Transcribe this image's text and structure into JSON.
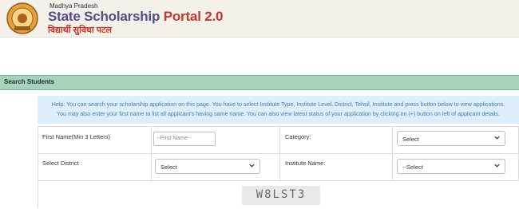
{
  "header": {
    "state_name": "Madhya Pradesh",
    "title_part1": "State Scholarship",
    "title_part2": "Portal 2.0",
    "hindi_tagline": "विद्यार्थी सुविधा पटल"
  },
  "section": {
    "title": "Search Students"
  },
  "help": {
    "line1": "Help: You can search your scholarship application on this page. You have to select Institute Type, Institute Level, District, Tehsil, Institute and press button below to view applications.",
    "line2": "You may also enter your first name to list all applicant's having same name. You can also view latest status of your application by clicking on (+) button on left of applicant details."
  },
  "form": {
    "first_name_label": "First Name(Min 3 Letters)",
    "first_name_placeholder": "--First Name--",
    "category_label": "Category:",
    "category_value": "Select",
    "district_label": "Select District :",
    "district_value": "Select",
    "institute_label": "Institute Name:",
    "institute_value": "--Select"
  },
  "captcha": {
    "text": "W8LST3"
  },
  "colors": {
    "section_bar": "#a7d3bd",
    "help_bg": "#dceef9",
    "title_purple": "#5a4a8a",
    "title_red": "#c0392b"
  }
}
